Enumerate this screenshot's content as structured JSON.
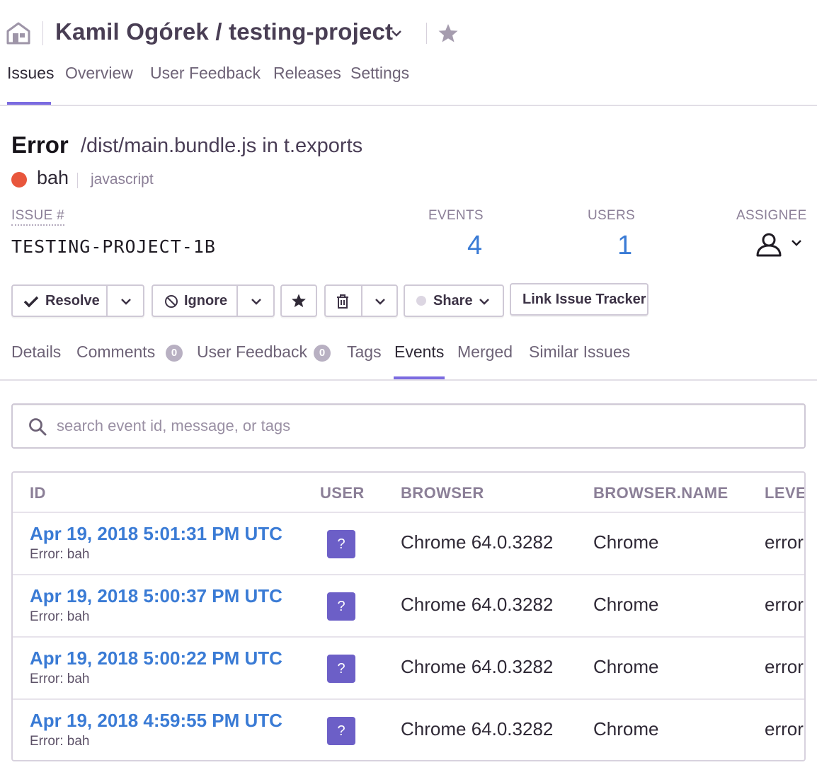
{
  "header": {
    "project_title": "Kamil Ogórek / testing-project",
    "nav": [
      "Issues",
      "Overview",
      "User Feedback",
      "Releases",
      "Settings"
    ],
    "active_nav": "Issues"
  },
  "issue": {
    "type": "Error",
    "culprit": "/dist/main.bundle.js in t.exports",
    "message": "bah",
    "platform": "javascript",
    "level_color": "#e8563c",
    "issue_label": "ISSUE #",
    "issue_id": "TESTING-PROJECT-1B",
    "events_label": "EVENTS",
    "events_count": "4",
    "users_label": "USERS",
    "users_count": "1",
    "assignee_label": "ASSIGNEE"
  },
  "actions": {
    "resolve": "Resolve",
    "ignore": "Ignore",
    "share": "Share",
    "link_tracker": "Link Issue Tracker"
  },
  "tabs": {
    "details": "Details",
    "comments": "Comments",
    "comments_count": "0",
    "user_feedback": "User Feedback",
    "user_feedback_count": "0",
    "tags": "Tags",
    "events": "Events",
    "merged": "Merged",
    "similar": "Similar Issues",
    "active": "Events"
  },
  "search": {
    "placeholder": "search event id, message, or tags",
    "value": ""
  },
  "table": {
    "columns": [
      "ID",
      "USER",
      "BROWSER",
      "BROWSER.NAME",
      "LEVE"
    ],
    "rows": [
      {
        "date": "Apr 19, 2018 5:01:31 PM UTC",
        "message": "Error: bah",
        "user": "?",
        "browser": "Chrome 64.0.3282",
        "browser_name": "Chrome",
        "level": "error"
      },
      {
        "date": "Apr 19, 2018 5:00:37 PM UTC",
        "message": "Error: bah",
        "user": "?",
        "browser": "Chrome 64.0.3282",
        "browser_name": "Chrome",
        "level": "error"
      },
      {
        "date": "Apr 19, 2018 5:00:22 PM UTC",
        "message": "Error: bah",
        "user": "?",
        "browser": "Chrome 64.0.3282",
        "browser_name": "Chrome",
        "level": "error"
      },
      {
        "date": "Apr 19, 2018 4:59:55 PM UTC",
        "message": "Error: bah",
        "user": "?",
        "browser": "Chrome 64.0.3282",
        "browser_name": "Chrome",
        "level": "error"
      }
    ]
  },
  "icons": {
    "home": "home-icon",
    "star": "star-icon",
    "chevron": "chevron-down-icon",
    "check": "check-icon",
    "ignore": "ban-icon",
    "bookmark": "star-icon",
    "delete": "trash-icon",
    "share_dot": "circle-icon",
    "assignee": "user-icon",
    "search": "search-icon"
  },
  "colors": {
    "accent": "#7b6be0",
    "link": "#3a7bd5",
    "avatar": "#6c5fc7",
    "error_dot": "#e8563c"
  }
}
